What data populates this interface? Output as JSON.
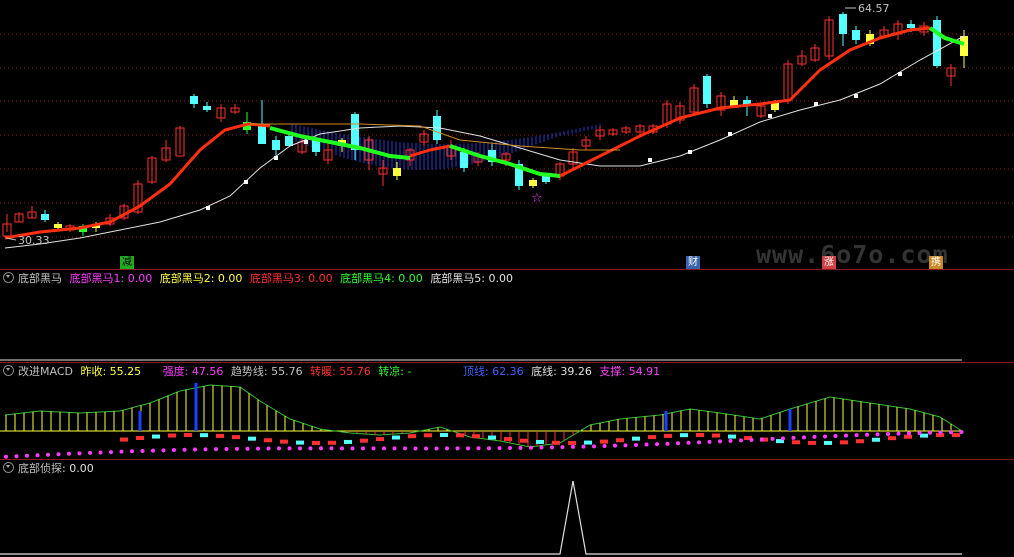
{
  "price_pane": {
    "high_label": "64.57",
    "low_label": "30.33",
    "watermark": "www.6o7o.com",
    "badges": [
      {
        "text": "减",
        "color": "#22aa22",
        "fg": "#000"
      },
      {
        "text": "财",
        "color": "#3a63b0",
        "fg": "#fff"
      },
      {
        "text": "涨",
        "color": "#d04040",
        "fg": "#fff"
      },
      {
        "text": "携",
        "color": "#c98a2a",
        "fg": "#fff"
      }
    ]
  },
  "pane2": {
    "title": "底部黑马",
    "items": [
      {
        "label": "底部黑马1: 0.00",
        "color": "#ff3cff"
      },
      {
        "label": "底部黑马2: 0.00",
        "color": "#ffff40"
      },
      {
        "label": "底部黑马3: 0.00",
        "color": "#ff3030"
      },
      {
        "label": "底部黑马4: 0.00",
        "color": "#30ff30"
      },
      {
        "label": "底部黑马5: 0.00",
        "color": "#e0e0e0"
      }
    ]
  },
  "pane3": {
    "title": "改进MACD",
    "items": [
      {
        "label": "昨收: 55.25",
        "color": "#ffff40"
      },
      {
        "label": "强度: 47.56",
        "color": "#ff3cff"
      },
      {
        "label": "趋势线: 55.76",
        "color": "#c0c0c0"
      },
      {
        "label": "转暖: 55.76",
        "color": "#ff3030"
      },
      {
        "label": "转凉: -",
        "color": "#30ff30"
      },
      {
        "label": "顶线: 62.36",
        "color": "#4060ff"
      },
      {
        "label": "底线: 39.26",
        "color": "#e0e0e0"
      },
      {
        "label": "支撑: 54.91",
        "color": "#ff3cff"
      }
    ]
  },
  "pane4": {
    "title": "底部侦探",
    "items": [
      {
        "label": ": 0.00",
        "color": "#e0e0e0"
      }
    ]
  },
  "colors": {
    "up": "#ff3030",
    "down": "#54ffff",
    "flat": "#ffff40",
    "ma_red": "#ff3010",
    "ma_green": "#20ff20",
    "ma_white": "#e0e0e0",
    "grid": "#8b1a1a"
  },
  "icons": [
    "star-icon"
  ]
}
